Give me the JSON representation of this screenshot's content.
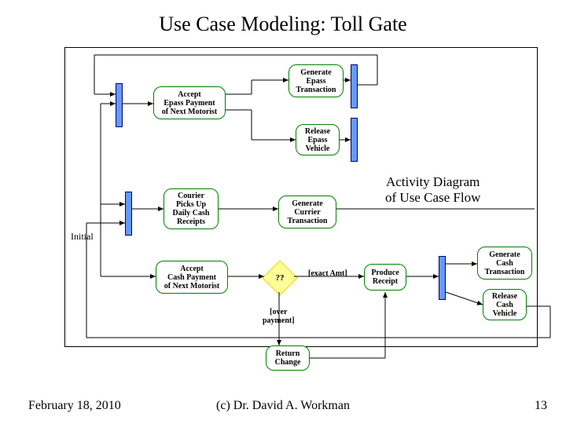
{
  "title": "Use Case Modeling: Toll Gate",
  "nodes": {
    "accept_epass": "Accept\nEpass Payment\nof Next Motorist",
    "gen_epass_tx": "Generate\nEpass\nTransaction",
    "release_epass": "Release\nEpass\nVehicle",
    "courier": "Courier\nPicks Up\nDaily Cash\nReceipts",
    "gen_currier_tx": "Generate\nCurrier\nTransaction",
    "accept_cash": "Accept\nCash Payment\nof Next Motorist",
    "produce_receipt": "Produce\nReceipt",
    "gen_cash_tx": "Generate\nCash\nTransaction",
    "release_cash": "Release\nCash\nVehicle",
    "return_change": "Return\nChange"
  },
  "decision_label": "??",
  "guards": {
    "exact": "[exact Amt]",
    "over": "[over\npayment]"
  },
  "labels": {
    "initial": "Initial"
  },
  "annotation": "Activity Diagram\nof Use Case Flow",
  "footer": {
    "date": "February 18, 2010",
    "copyright": "(c) Dr. David A. Workman",
    "page": "13"
  }
}
